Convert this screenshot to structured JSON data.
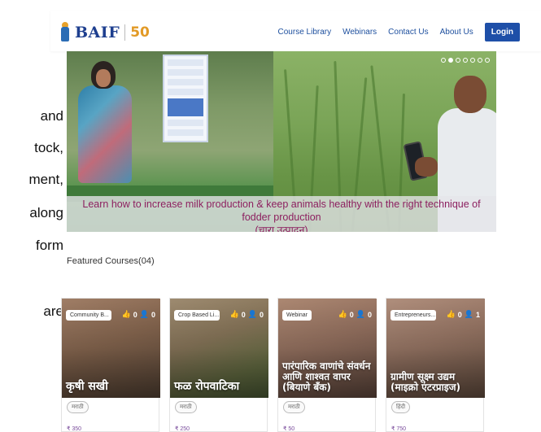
{
  "side_text": [
    "and",
    "tock,",
    "ment,",
    "along",
    "form",
    "are"
  ],
  "header": {
    "logo_text": "BAIF",
    "logo_badge": "50",
    "nav": [
      "Course Library",
      "Webinars",
      "Contact Us",
      "About Us"
    ],
    "login_label": "Login"
  },
  "hero": {
    "caption_line1": "Learn how to increase milk production & keep animals healthy with the right technique of fodder production",
    "caption_line2": "(चारा उत्पादन)",
    "slide_count": 7,
    "active_slide": 1
  },
  "featured": {
    "title": "Featured Courses(04)"
  },
  "courses": [
    {
      "category": "Community B...",
      "likes": "0",
      "users": "0",
      "title": "कृषी सखी",
      "language": "मराठी",
      "price": "₹ 350"
    },
    {
      "category": "Crop Based Li...",
      "likes": "0",
      "users": "0",
      "title": "फळ रोपवाटिका",
      "language": "मराठी",
      "price": "₹ 250"
    },
    {
      "category": "Webinar",
      "likes": "0",
      "users": "0",
      "title": "पारंपारिक वाणांचे संवर्धन आणि शाश्वत वापर (बियाणे बँक)",
      "language": "मराठी",
      "price": "₹ 50"
    },
    {
      "category": "Entrepreneurs...",
      "likes": "0",
      "users": "1",
      "title": "ग्रामीण सूक्ष्म उद्यम (माइक्रो एंटरप्राइज)",
      "language": "हिंदी",
      "price": "₹ 750"
    }
  ],
  "colors": {
    "brand_blue": "#1e4fa8",
    "caption_text": "#8c1f5f",
    "price_text": "#7a4c9c"
  }
}
